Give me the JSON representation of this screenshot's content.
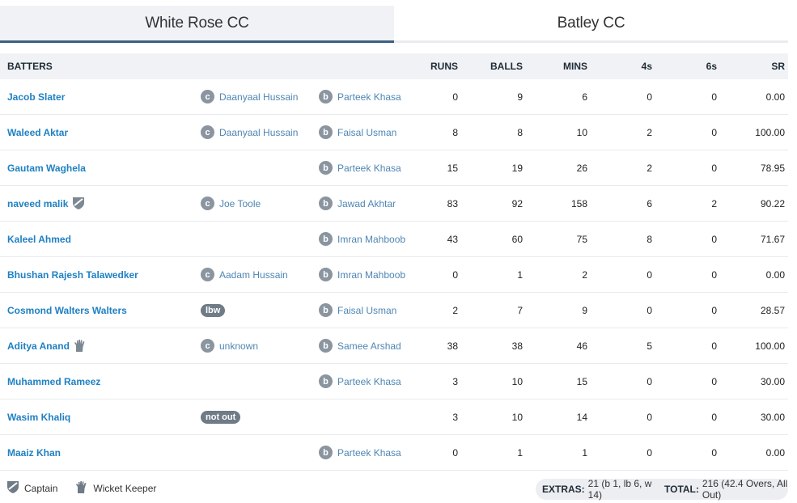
{
  "tabs": [
    {
      "label": "White Rose CC",
      "active": true
    },
    {
      "label": "Batley CC",
      "active": false
    }
  ],
  "columns": {
    "batters": "BATTERS",
    "runs": "RUNS",
    "balls": "BALLS",
    "mins": "MINS",
    "fours": "4s",
    "sixes": "6s",
    "sr": "SR"
  },
  "rows": [
    {
      "name": "Jacob Slater",
      "how_type": "c",
      "how_fielder": "Daanyaal Hussain",
      "bowler": "Parteek Khasa",
      "runs": "0",
      "balls": "9",
      "mins": "6",
      "fours": "0",
      "sixes": "0",
      "sr": "0.00"
    },
    {
      "name": "Waleed Aktar",
      "how_type": "c",
      "how_fielder": "Daanyaal Hussain",
      "bowler": "Faisal Usman",
      "runs": "8",
      "balls": "8",
      "mins": "10",
      "fours": "2",
      "sixes": "0",
      "sr": "100.00"
    },
    {
      "name": "Gautam Waghela",
      "how_type": "",
      "how_fielder": "",
      "bowler": "Parteek Khasa",
      "runs": "15",
      "balls": "19",
      "mins": "26",
      "fours": "2",
      "sixes": "0",
      "sr": "78.95"
    },
    {
      "name": "naveed malik",
      "role_icon": "captain-icon",
      "how_type": "c",
      "how_fielder": "Joe Toole",
      "bowler": "Jawad Akhtar",
      "runs": "83",
      "balls": "92",
      "mins": "158",
      "fours": "6",
      "sixes": "2",
      "sr": "90.22"
    },
    {
      "name": "Kaleel Ahmed",
      "how_type": "",
      "how_fielder": "",
      "bowler": "Imran Mahboob",
      "runs": "43",
      "balls": "60",
      "mins": "75",
      "fours": "8",
      "sixes": "0",
      "sr": "71.67"
    },
    {
      "name": "Bhushan Rajesh Talawedker",
      "how_type": "c",
      "how_fielder": "Aadam Hussain",
      "bowler": "Imran Mahboob",
      "runs": "0",
      "balls": "1",
      "mins": "2",
      "fours": "0",
      "sixes": "0",
      "sr": "0.00"
    },
    {
      "name": "Cosmond Walters Walters",
      "how_type": "lbw",
      "how_fielder": "",
      "bowler": "Faisal Usman",
      "runs": "2",
      "balls": "7",
      "mins": "9",
      "fours": "0",
      "sixes": "0",
      "sr": "28.57"
    },
    {
      "name": "Aditya Anand",
      "role_icon": "wicket-keeper-icon",
      "how_type": "c",
      "how_fielder": "unknown",
      "bowler": "Samee Arshad",
      "runs": "38",
      "balls": "38",
      "mins": "46",
      "fours": "5",
      "sixes": "0",
      "sr": "100.00"
    },
    {
      "name": "Muhammed Rameez",
      "how_type": "",
      "how_fielder": "",
      "bowler": "Parteek Khasa",
      "runs": "3",
      "balls": "10",
      "mins": "15",
      "fours": "0",
      "sixes": "0",
      "sr": "30.00"
    },
    {
      "name": "Wasim Khaliq",
      "how_type": "not out",
      "how_fielder": "",
      "bowler": "",
      "runs": "3",
      "balls": "10",
      "mins": "14",
      "fours": "0",
      "sixes": "0",
      "sr": "30.00"
    },
    {
      "name": "Maaiz Khan",
      "how_type": "",
      "how_fielder": "",
      "bowler": "Parteek Khasa",
      "runs": "0",
      "balls": "1",
      "mins": "1",
      "fours": "0",
      "sixes": "0",
      "sr": "0.00"
    }
  ],
  "badges": {
    "caught": "c",
    "bowled": "b"
  },
  "legend": {
    "captain": "Captain",
    "wicket_keeper": "Wicket Keeper"
  },
  "summary": {
    "extras_label": "EXTRAS:",
    "extras_value": "21 (b 1, lb 6, w 14)",
    "total_label": "TOTAL:",
    "total_value": "216 (42.4 Overs, All Out)"
  },
  "colors": {
    "link": "#1f80c3",
    "fielder": "#4f86b4",
    "badge": "#8a95a0",
    "pill": "#6f7b86",
    "tab_active_border": "#3a5f82"
  }
}
